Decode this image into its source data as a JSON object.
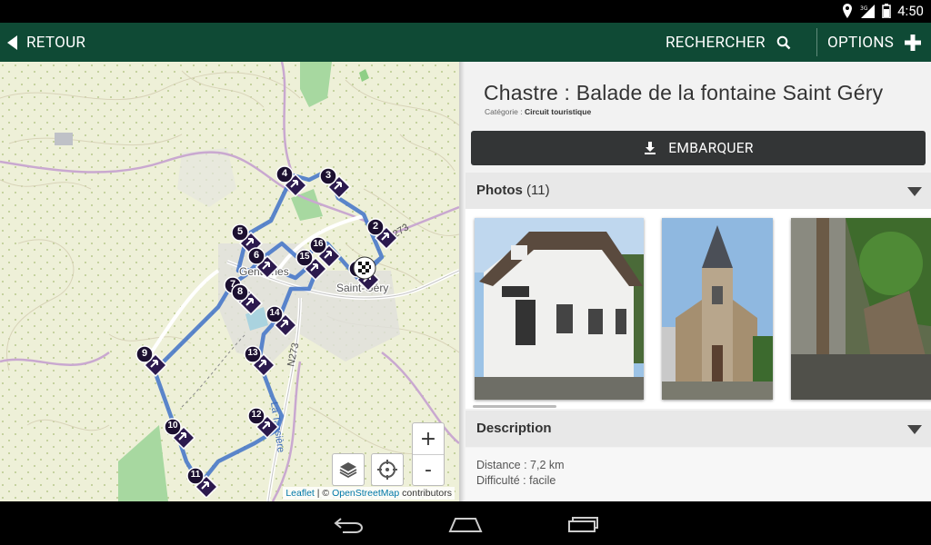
{
  "status_bar": {
    "time": "4:50",
    "network": "3G"
  },
  "app_bar": {
    "back_label": "RETOUR",
    "search_label": "RECHERCHER",
    "options_label": "OPTIONS"
  },
  "map": {
    "labels": {
      "village1": "Gentinnes",
      "village2": "Saint-Géry",
      "road1": "N273",
      "road2": "N273",
      "street": "La Tassière"
    },
    "waypoints": [
      "1",
      "2",
      "3",
      "4",
      "5",
      "6",
      "7",
      "8",
      "9",
      "10",
      "11",
      "12",
      "13",
      "14",
      "15",
      "16"
    ],
    "zoom_in": "+",
    "zoom_out": "-",
    "attribution": {
      "leaflet": "Leaflet",
      "sep": " | © ",
      "osm": "OpenStreetMap",
      "contributors": " contributors"
    }
  },
  "detail": {
    "title": "Chastre : Balade de la fontaine Saint Géry",
    "category_label": "Catégorie :",
    "category_value": "Circuit touristique",
    "embark_label": "EMBARQUER",
    "photos_label": "Photos",
    "photos_count": "(11)",
    "description_label": "Description",
    "distance": "Distance : 7,2 km",
    "difficulty": "Difficulté : facile"
  },
  "colors": {
    "app_bar": "#0f4a35",
    "route": "#3f72c8",
    "marker": "#2c1a4e",
    "button_dark": "#333536"
  }
}
